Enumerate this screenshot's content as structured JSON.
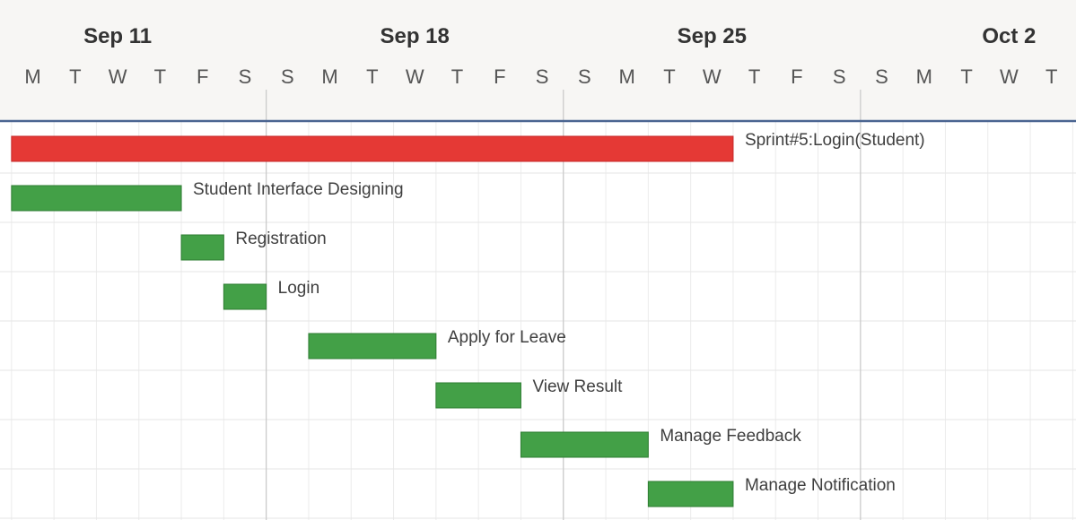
{
  "chart_data": {
    "type": "gantt",
    "week_headers": [
      "Sep 11",
      "Sep 18",
      "Sep 25",
      "Oct 2"
    ],
    "day_headers": [
      "M",
      "T",
      "W",
      "T",
      "F",
      "S",
      "S",
      "M",
      "T",
      "W",
      "T",
      "F",
      "S",
      "S",
      "M",
      "T",
      "W",
      "T",
      "F",
      "S",
      "S",
      "M",
      "T",
      "W",
      "T"
    ],
    "timeline": {
      "first_day": "2023-09-10",
      "last_day": "2023-10-04"
    },
    "tasks": [
      {
        "name": "Sprint#5:Login(Student)",
        "start": "2023-09-11",
        "end": "2023-09-27",
        "kind": "sprint"
      },
      {
        "name": "Student Interface Designing",
        "start": "2023-09-11",
        "end": "2023-09-14",
        "kind": "task"
      },
      {
        "name": "Registration",
        "start": "2023-09-15",
        "end": "2023-09-15",
        "kind": "task"
      },
      {
        "name": "Login",
        "start": "2023-09-16",
        "end": "2023-09-16",
        "kind": "task"
      },
      {
        "name": "Apply for Leave",
        "start": "2023-09-18",
        "end": "2023-09-20",
        "kind": "task"
      },
      {
        "name": "View Result",
        "start": "2023-09-21",
        "end": "2023-09-22",
        "kind": "task"
      },
      {
        "name": "Manage Feedback",
        "start": "2023-09-23",
        "end": "2023-09-25",
        "kind": "task"
      },
      {
        "name": "Manage Notification",
        "start": "2023-09-26",
        "end": "2023-09-27",
        "kind": "task"
      }
    ],
    "colors": {
      "sprint": "#e53935",
      "task": "#43a047",
      "header_bg": "#f7f6f4",
      "header_rule": "#4a6591"
    }
  }
}
